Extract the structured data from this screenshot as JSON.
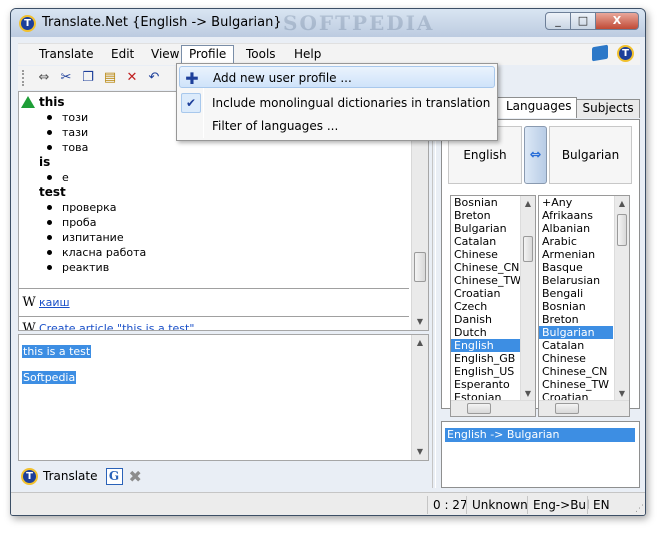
{
  "window": {
    "title": "Translate.Net   {English -> Bulgarian}",
    "watermark": "SOFTPEDIA",
    "app_icon_letter": "T",
    "minimize": "_",
    "maximize": "□",
    "close": "X"
  },
  "menu": {
    "items": [
      "Translate",
      "Edit",
      "View",
      "Profile",
      "Tools",
      "Help"
    ],
    "active": "Profile"
  },
  "profile_menu": {
    "items": [
      {
        "label": "Add new user profile ...",
        "icon": "plus-icon",
        "highlighted": true
      },
      {
        "label": "Include monolingual dictionaries in translation",
        "icon": "check-icon",
        "checked": true
      },
      {
        "label": "Filter of languages ...",
        "icon": null
      }
    ]
  },
  "toolbar": {
    "icons": [
      "back-icon",
      "cut-icon",
      "copy-icon",
      "paste-icon",
      "delete-icon",
      "undo-icon"
    ]
  },
  "results": {
    "entries": [
      {
        "word": "this",
        "translations": [
          "този",
          "тази",
          "това"
        ]
      },
      {
        "word": "is",
        "translations": [
          "е"
        ]
      },
      {
        "word": "test",
        "translations": [
          "проверка",
          "проба",
          "изпитание",
          "класна работа",
          "реактив"
        ]
      }
    ],
    "wiki_links": [
      {
        "icon": "W",
        "text": "каиш"
      },
      {
        "icon": "W",
        "text": "Create article \"this is a test\""
      }
    ]
  },
  "input": {
    "lines": [
      "this is a test",
      "Softpedia"
    ]
  },
  "bottom_bar": {
    "translate_label": "Translate",
    "google_letter": "G"
  },
  "right_panel": {
    "tabs": [
      "Languages",
      "Subjects"
    ],
    "active_tab": "Languages",
    "from_language": "English",
    "to_language": "Bulgarian",
    "source_languages": [
      "Bosnian",
      "Breton",
      "Bulgarian",
      "Catalan",
      "Chinese",
      "Chinese_CN",
      "Chinese_TW",
      "Croatian",
      "Czech",
      "Danish",
      "Dutch",
      "English",
      "English_GB",
      "English_US",
      "Esperanto",
      "Estonian"
    ],
    "source_selected": "English",
    "target_languages": [
      "+Any",
      "Afrikaans",
      "Albanian",
      "Arabic",
      "Armenian",
      "Basque",
      "Belarusian",
      "Bengali",
      "Bosnian",
      "Breton",
      "Bulgarian",
      "Catalan",
      "Chinese",
      "Chinese_CN",
      "Chinese_TW",
      "Croatian"
    ],
    "target_selected": "Bulgarian",
    "directions": [
      "English -> Bulgarian"
    ]
  },
  "status_bar": {
    "time": "0 : 27",
    "state": "Unknown",
    "direction": "Eng->Bul",
    "locale": "EN"
  }
}
